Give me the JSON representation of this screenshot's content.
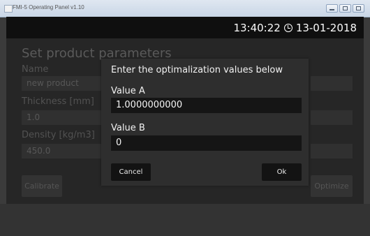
{
  "window": {
    "title": "FMI-5 Operating Panel v1.10"
  },
  "header": {
    "time": "13:40:22",
    "date": "13-01-2018"
  },
  "background_form": {
    "title": "Set product parameters",
    "fields": [
      {
        "label": "Name",
        "value": "new product"
      },
      {
        "label": "Thickness [mm]",
        "value": "1.0"
      },
      {
        "label": "Density [kg/m3]",
        "value": "450.0"
      }
    ],
    "calibrate_label": "Calibrate",
    "optimize_label": "Optimize"
  },
  "dialog": {
    "title": "Enter the optimalization values below",
    "value_a_label": "Value A",
    "value_a": "1.0000000000",
    "value_b_label": "Value B",
    "value_b": "0",
    "cancel_label": "Cancel",
    "ok_label": "Ok"
  }
}
